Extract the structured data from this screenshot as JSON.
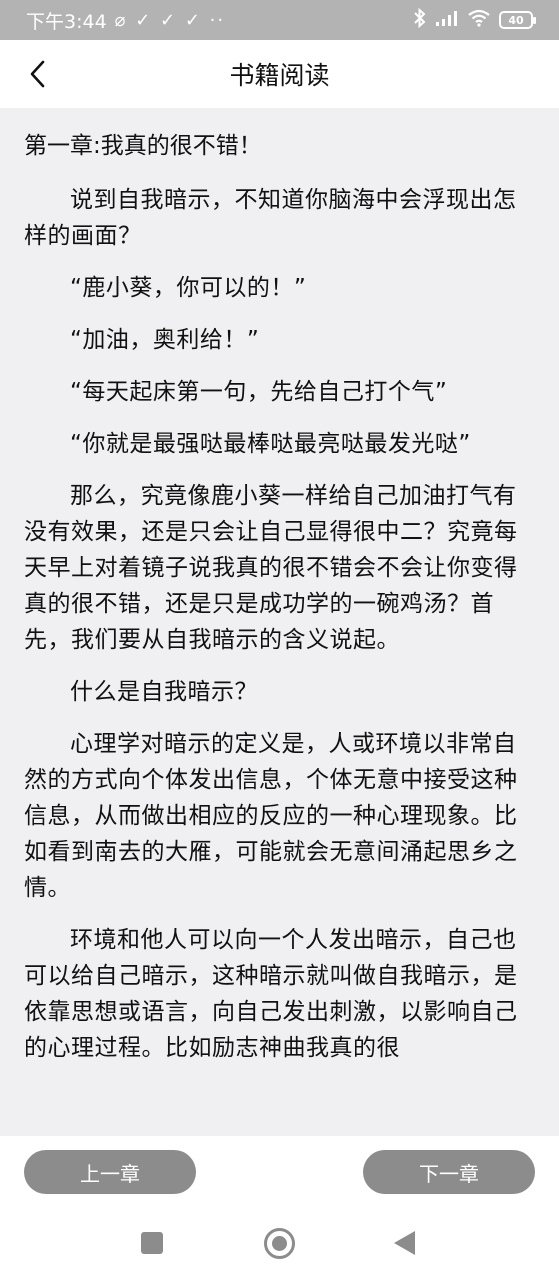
{
  "status_bar": {
    "time": "下午3:44",
    "notification_icons": "⌀ ✓ ✓ ✓ ··",
    "battery": "40"
  },
  "header": {
    "title": "书籍阅读"
  },
  "content": {
    "chapter_title": "第一章:我真的很不错！",
    "paragraphs": [
      "说到自我暗示，不知道你脑海中会浮现出怎样的画面？",
      "“鹿小葵，你可以的！”",
      "“加油，奥利给！”",
      "“每天起床第一句，先给自己打个气”",
      "“你就是最强哒最棒哒最亮哒最发光哒”",
      "那么，究竟像鹿小葵一样给自己加油打气有没有效果，还是只会让自己显得很中二？究竟每天早上对着镜子说我真的很不错会不会让你变得真的很不错，还是只是成功学的一碗鸡汤？首先，我们要从自我暗示的含义说起。",
      "什么是自我暗示？",
      "心理学对暗示的定义是，人或环境以非常自然的方式向个体发出信息，个体无意中接受这种信息，从而做出相应的反应的一种心理现象。比如看到南去的大雁，可能就会无意间涌起思乡之情。",
      "环境和他人可以向一个人发出暗示，自己也可以给自己暗示，这种暗示就叫做自我暗示，是依靠思想或语言，向自己发出刺激，以影响自己的心理过程。比如励志神曲我真的很"
    ]
  },
  "chapter_nav": {
    "prev_label": "上一章",
    "next_label": "下一章"
  },
  "colors": {
    "status_bar_bg": "#b3b3b3",
    "content_bg": "#f0f0f2",
    "button_bg": "#8c8c8c"
  }
}
